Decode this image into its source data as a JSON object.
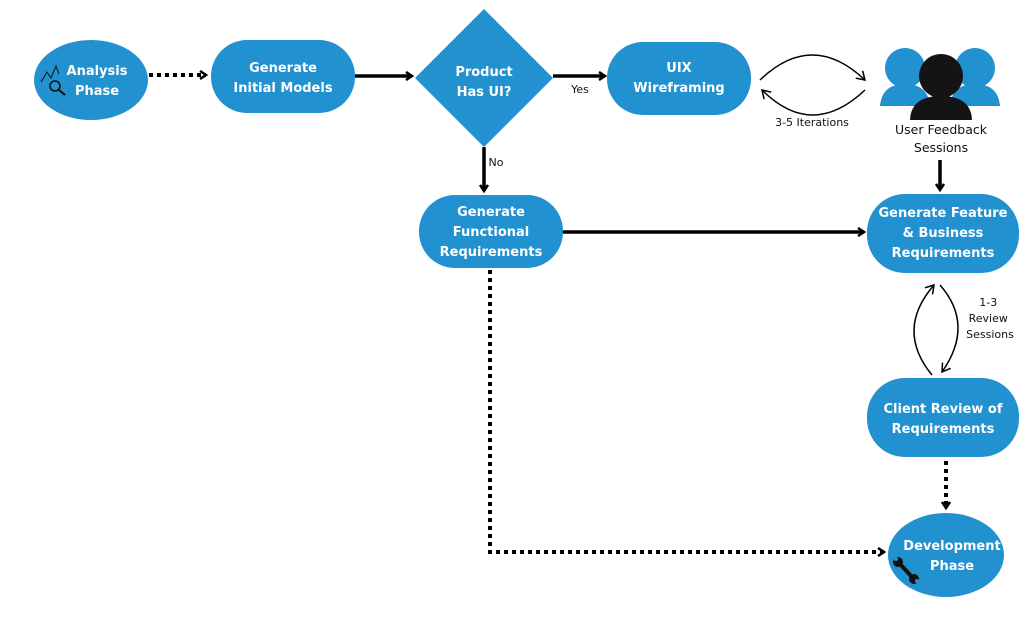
{
  "colors": {
    "node": "#2191d0",
    "edge": "#000000",
    "icon": "#141414"
  },
  "nodes": {
    "analysis": [
      "Analysis",
      "Phase"
    ],
    "initial_models": [
      "Generate",
      "Initial Models"
    ],
    "decision": [
      "Product",
      "Has UI?"
    ],
    "uix": [
      "UIX",
      "Wireframing"
    ],
    "user_feedback": [
      "User Feedback",
      "Sessions"
    ],
    "functional": [
      "Generate",
      "Functional",
      "Requirements"
    ],
    "feature_business": [
      "Generate Feature",
      "& Business",
      "Requirements"
    ],
    "client_review": [
      "Client Review of",
      "Requirements"
    ],
    "development": [
      "Development",
      "Phase"
    ]
  },
  "edge_labels": {
    "yes": "Yes",
    "no": "No",
    "iterations": "3-5 Iterations",
    "review": [
      "1-3",
      "Review",
      "Sessions"
    ]
  },
  "icons": {
    "analysis": "chart-magnifier-icon",
    "users": "users-group-icon",
    "development": "wrench-icon"
  }
}
